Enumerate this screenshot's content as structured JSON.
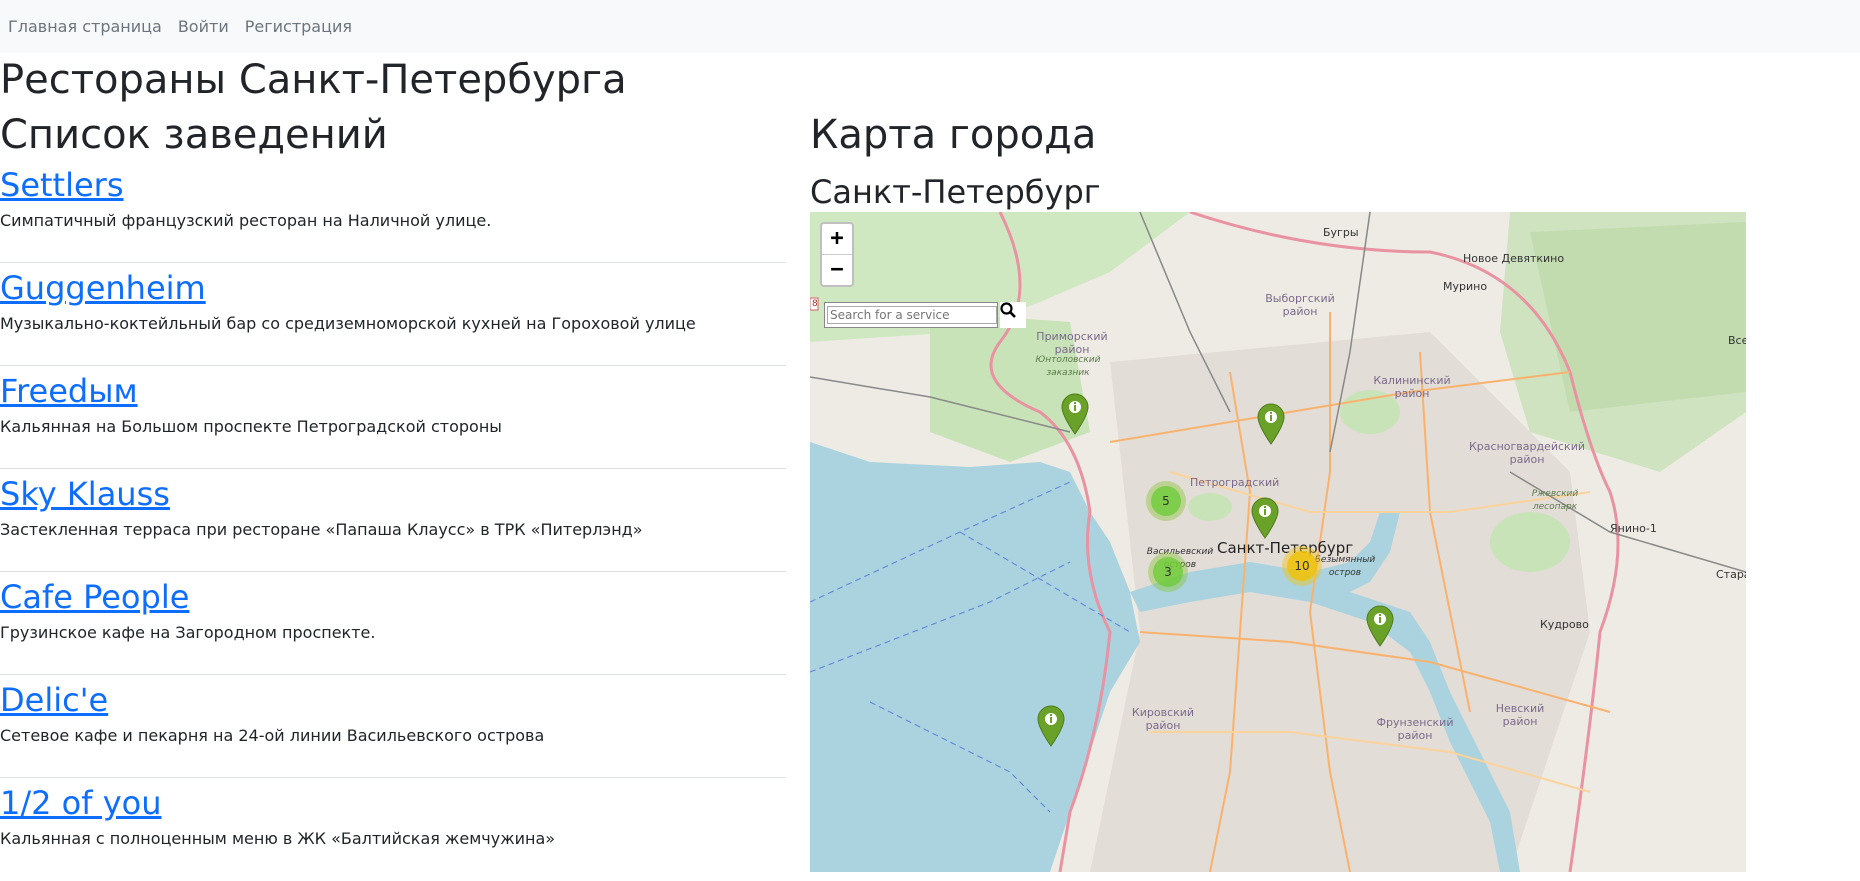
{
  "nav": {
    "home": "Главная страница",
    "login": "Войти",
    "register": "Регистрация"
  },
  "page_title": "Рестораны Санкт-Петербурга",
  "list_title": "Список заведений",
  "venues": [
    {
      "name": "Settlers",
      "desc": "Симпатичный французский ресторан на Наличной улице."
    },
    {
      "name": "Guggenheim",
      "desc": "Музыкально-коктейльный бар со средиземноморской кухней на Гороховой улице"
    },
    {
      "name": "Freedым",
      "desc": "Кальянная на Большом проспекте Петроградской стороны"
    },
    {
      "name": "Sky Klauss",
      "desc": "Застекленная терраса при ресторане «Папаша Клаусс» в ТРК «Питерлэнд»"
    },
    {
      "name": "Cafe People",
      "desc": "Грузинское кафе на Загородном проспекте."
    },
    {
      "name": "Delic'e",
      "desc": "Сетевое кафе и пекарня на 24-ой линии Васильевского острова"
    },
    {
      "name": "1/2 of you",
      "desc": "Кальянная с полноценным меню в ЖК «Балтийская жемчужина»"
    }
  ],
  "map_title": "Карта города",
  "city_title": "Санкт-Петербург",
  "map": {
    "zoom_in": "+",
    "zoom_out": "−",
    "search_placeholder": "Search for a service",
    "edge_number": "8",
    "labels": {
      "bugry": "Бугры",
      "novoe_devyatkino": "Новое Девяткино",
      "murino": "Мурино",
      "vse": "Все",
      "vyborgsky": "Выборгский район",
      "primorsky": "Приморский район",
      "yuntolovsky": "Юнтоловский заказник",
      "kalininsky": "Калининский район",
      "krasnogvardeysky": "Красногвардейский район",
      "rzhevsky": "Ржевский лесопарк",
      "yanino": "Янино-1",
      "petrogradsky": "Петроградский",
      "vasilievsky": "Васильевский остров",
      "spb": "Санкт-Петербург",
      "bezymyanny": "Безымянный остров",
      "kudrovo": "Кудрово",
      "stara": "Стара",
      "kirovsky": "Кировский район",
      "frunzensky": "Фрунзенский район",
      "nevsky": "Невский район"
    },
    "clusters": [
      {
        "count": "5"
      },
      {
        "count": "3"
      },
      {
        "count": "10"
      }
    ]
  },
  "colors": {
    "link": "#0d6efd",
    "navbar_bg": "#f8f9fa",
    "water": "#aad3df",
    "pin": "#6aa128",
    "cluster_small": "#8cc63f",
    "cluster_medium": "#f0c419"
  }
}
